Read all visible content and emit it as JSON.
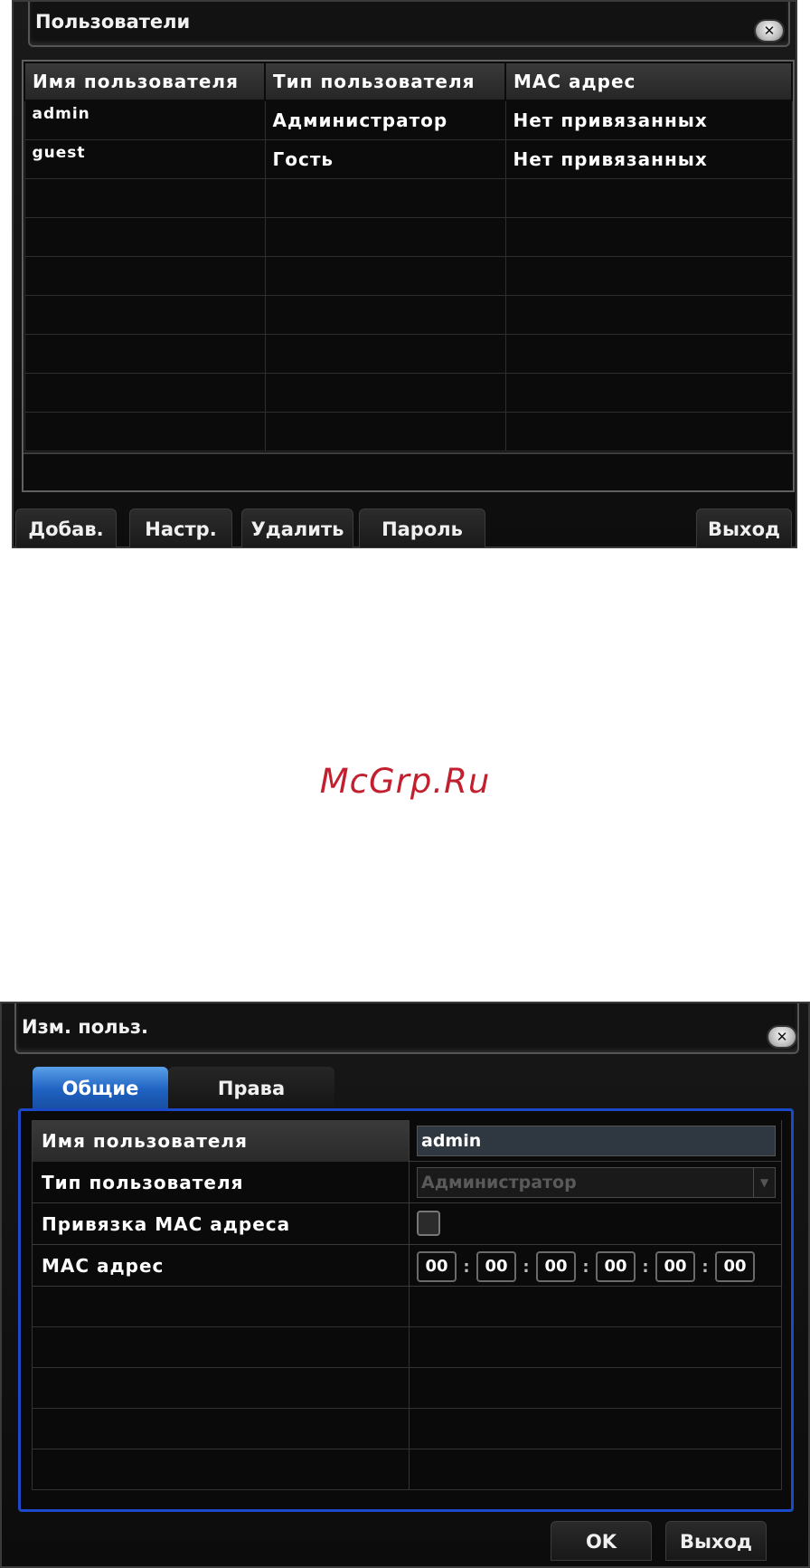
{
  "users_dialog": {
    "title": "Пользователи",
    "close_icon": "close-icon",
    "columns": [
      "Имя пользователя",
      "Тип пользователя",
      "МАС адрес"
    ],
    "rows": [
      {
        "name": "admin",
        "type": "Администратор",
        "mac": "Нет привязанных"
      },
      {
        "name": "guest",
        "type": "Гость",
        "mac": "Нет привязанных"
      }
    ],
    "buttons": {
      "add": "Добав.",
      "settings": "Настр.",
      "delete": "Удалить",
      "password": "Пароль",
      "exit": "Выход"
    }
  },
  "watermark": "McGrp.Ru",
  "edit_dialog": {
    "title": "Изм. польз.",
    "close_icon": "close-icon",
    "tabs": {
      "general": "Общие",
      "rights": "Права"
    },
    "fields": {
      "username_label": "Имя пользователя",
      "username_value": "admin",
      "usertype_label": "Тип пользователя",
      "usertype_value": "Администратор",
      "mac_bind_label": "Привязка МАС адреса",
      "mac_bind_checked": false,
      "mac_label": "МАС адрес",
      "mac_octets": [
        "00",
        "00",
        "00",
        "00",
        "00",
        "00"
      ]
    },
    "buttons": {
      "ok": "OK",
      "exit": "Выход"
    }
  }
}
